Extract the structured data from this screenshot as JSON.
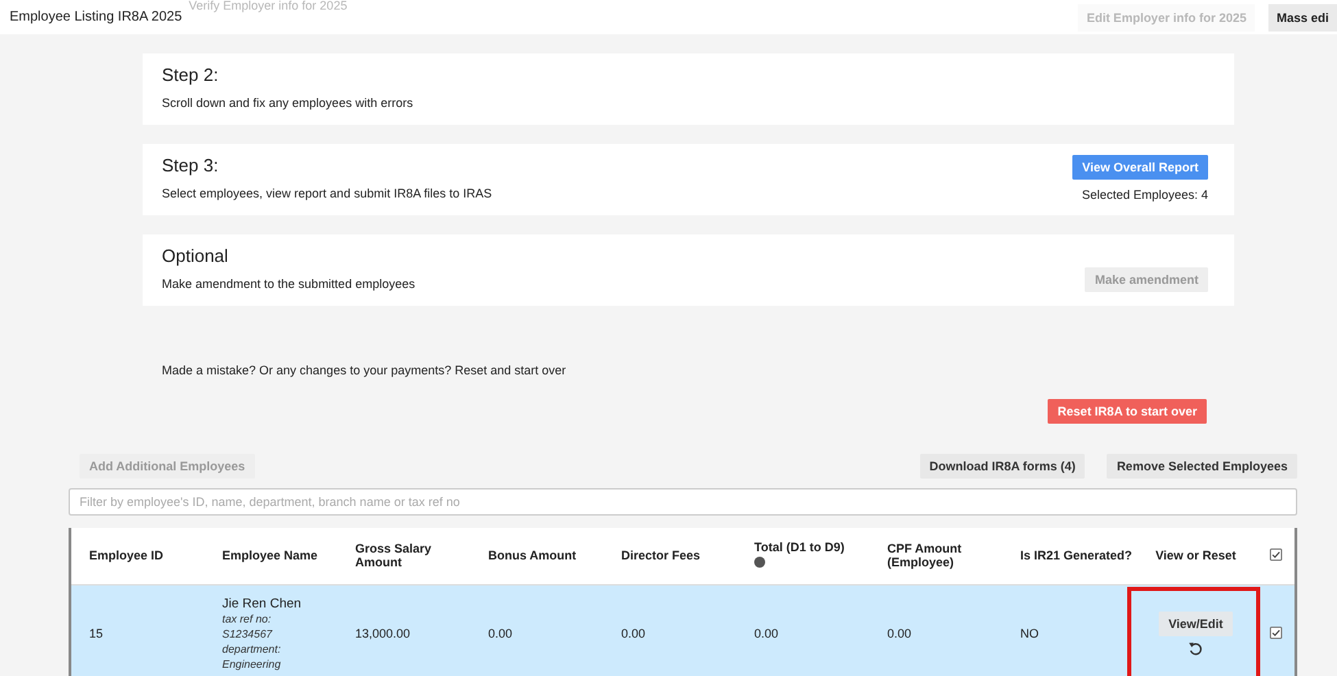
{
  "top_bar": {
    "title": "Employee Listing IR8A 2025",
    "faded_note": "Verify Employer info for 2025",
    "buttons": [
      {
        "label": "Edit Employer info for 2025",
        "faded": true
      },
      {
        "label": "Mass edi",
        "faded": false
      }
    ]
  },
  "steps": [
    {
      "title": "Step 2:",
      "description": "Scroll down and fix any employees with errors"
    },
    {
      "title": "Step 3:",
      "description": "Select employees, view report and submit IR8A files to IRAS",
      "button": {
        "label": "View Overall Report",
        "kind": "primary",
        "disabled": false
      },
      "note": "Selected Employees: 4"
    },
    {
      "title": "Optional",
      "description": "Make amendment to the submitted employees",
      "button": {
        "label": "Make amendment",
        "kind": "default",
        "disabled": true
      }
    }
  ],
  "reset": {
    "text": "Made a mistake? Or any changes to your payments? Reset and start over",
    "button": {
      "label": "Reset IR8A to start over",
      "kind": "danger",
      "disabled": false
    }
  },
  "actions": [
    {
      "label": "Add Additional Employees",
      "disabled": true
    },
    {
      "label": "Download IR8A forms (4)",
      "disabled": false
    },
    {
      "label": "Remove Selected Employees",
      "disabled": false
    }
  ],
  "filter": {
    "placeholder": "Filter by employee's ID, name, department, branch name or tax ref no"
  },
  "table": {
    "columns": [
      {
        "label": "Employee ID",
        "info": false
      },
      {
        "label": "Employee Name",
        "info": false
      },
      {
        "label": "Gross Salary Amount",
        "info": false
      },
      {
        "label": "Bonus Amount",
        "info": false
      },
      {
        "label": "Director Fees",
        "info": false
      },
      {
        "label": "Total (D1 to D9)",
        "info": true
      },
      {
        "label": "CPF Amount (Employee)",
        "info": false
      },
      {
        "label": "Is IR21 Generated?",
        "info": false
      },
      {
        "label": "View or Reset",
        "info": false
      }
    ],
    "all_checked": true,
    "rows": [
      {
        "selected": true,
        "checked": true,
        "id": "15",
        "name": "Jie Ren Chen",
        "details": [
          "tax ref no:",
          "S1234567",
          "department:",
          "Engineering"
        ],
        "values": [
          "13,000.00",
          "0.00",
          "0.00",
          "0.00",
          "0.00",
          "NO"
        ],
        "view_button": "View/Edit",
        "highlighted": true
      }
    ]
  }
}
